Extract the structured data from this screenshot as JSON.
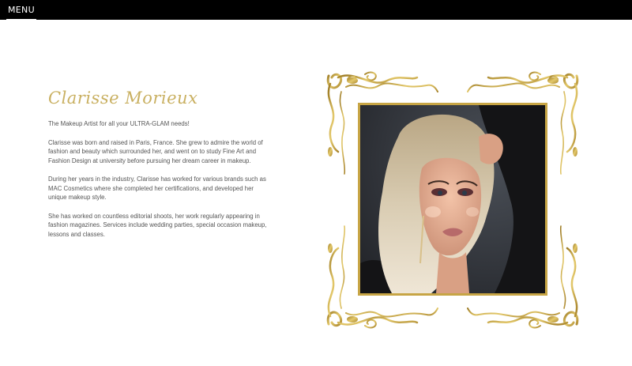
{
  "nav": {
    "menu_label": "MENU"
  },
  "bio": {
    "name": "Clarisse Morieux",
    "tagline": "The Makeup Artist for all your ULTRA-GLAM needs!",
    "paragraphs": [
      "Clarisse was born and raised in Paris, France. She grew to admire the world of fashion and beauty which surrounded her, and went on to study Fine Art and Fashion Design at university before pursuing her dream career in makeup.",
      "During her years in the industry, Clarisse has worked for various brands such as MAC Cosmetics where she completed her certifications, and developed her unique makeup style.",
      "She has worked on countless editorial shoots, her work regularly appearing in fashion magazines. Services include wedding parties, special occasion makeup, lessons and classes."
    ]
  },
  "colors": {
    "gold": "#c7a545",
    "name_gold": "#c9b061",
    "nav_bg": "#000000"
  }
}
